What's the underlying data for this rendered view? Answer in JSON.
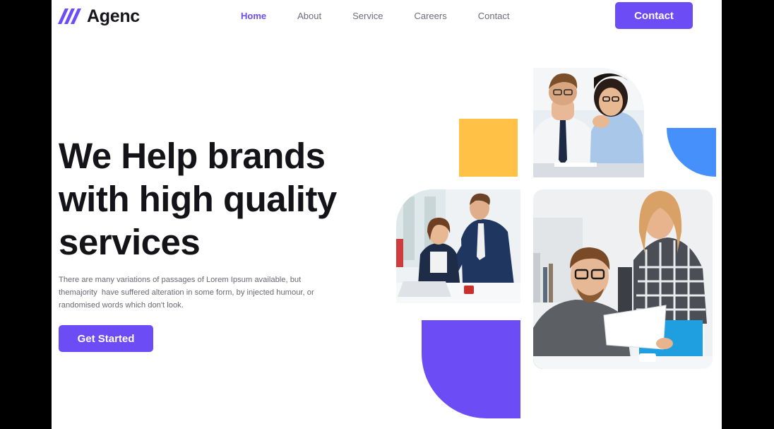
{
  "brand": {
    "name": "Agenc",
    "accent": "#6c4cf4"
  },
  "nav": {
    "items": [
      {
        "label": "Home",
        "active": true
      },
      {
        "label": "About",
        "active": false
      },
      {
        "label": "Service",
        "active": false
      },
      {
        "label": "Careers",
        "active": false
      },
      {
        "label": "Contact",
        "active": false
      }
    ]
  },
  "header": {
    "contact_button": "Contact"
  },
  "hero": {
    "title_line1": "We Help brands",
    "title_line2": "with high quality",
    "title_line3": "services",
    "desc_line1": "There are many variations of passages of Lorem Ipsum available, but",
    "desc_line2": "themajority  have suffered alteration in some form, by injected humour, or",
    "desc_line3": "randomised words which don't look.",
    "cta": "Get Started"
  },
  "collage": {
    "yellow": "#ffc247",
    "blue": "#4690fb",
    "purple": "#6c4cf4"
  }
}
